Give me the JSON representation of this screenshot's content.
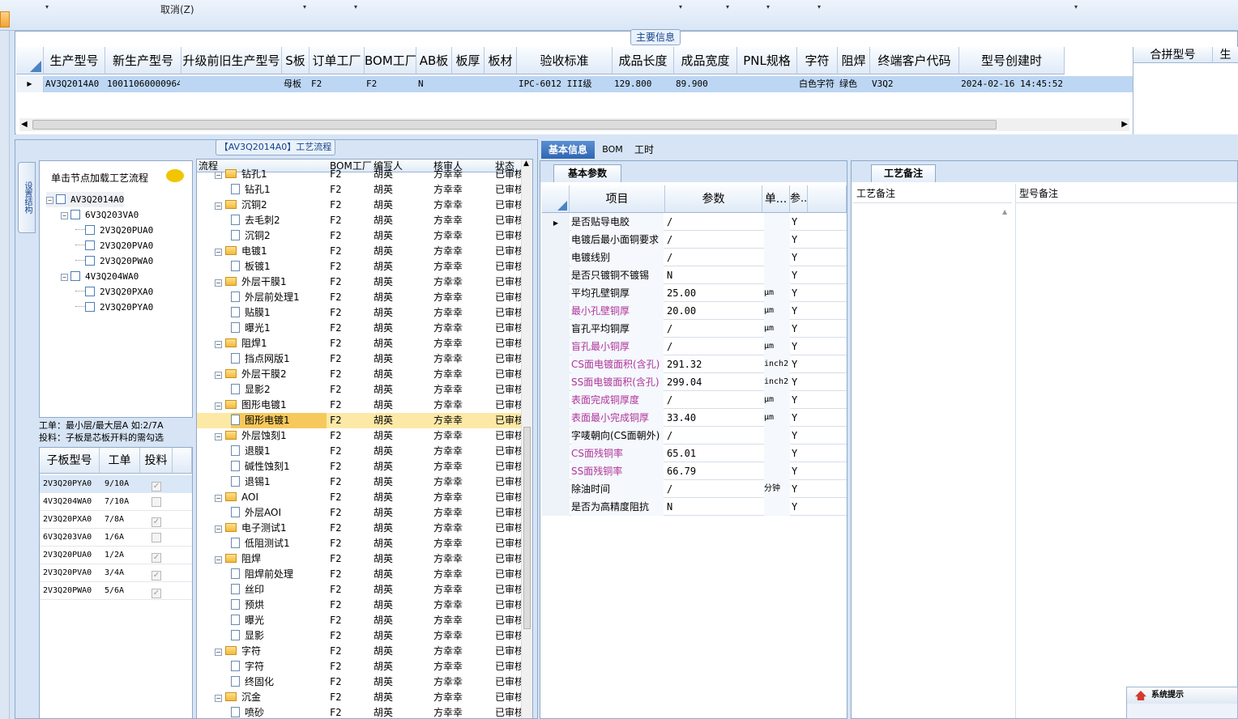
{
  "toolbar": {
    "cancel_label": "取消(Z)",
    "dropdown_glyph": "▾"
  },
  "main_info": {
    "legend": "主要信息",
    "columns": [
      "生产型号",
      "新生产型号",
      "升级前旧生产型号",
      "S板",
      "订单工厂",
      "BOM工厂",
      "AB板",
      "板厚",
      "板材",
      "验收标准",
      "成品长度",
      "成品宽度",
      "PNL规格",
      "字符",
      "阻焊",
      "终端客户代码",
      "型号创建时"
    ],
    "row": [
      "AV3Q2014A0",
      "10011060000964",
      "",
      "母板",
      "F2",
      "F2",
      "N",
      "",
      "",
      "IPC-6012 III级",
      "129.800",
      "89.900",
      "",
      "白色字符",
      "绿色",
      "V3Q2",
      "2024-02-16 14:45:52"
    ],
    "merge_columns": [
      "合拼型号",
      "生"
    ]
  },
  "process_flow": {
    "title": "【AV3Q2014A0】工艺流程"
  },
  "side_tab": "设置结构",
  "tree_panel": {
    "hint": "单击节点加载工艺流程",
    "nodes": [
      {
        "label": "AV3Q2014A0",
        "level": 0,
        "expand": "−"
      },
      {
        "label": "6V3Q203VA0",
        "level": 1,
        "expand": "−"
      },
      {
        "label": "2V3Q20PUA0",
        "level": 2,
        "expand": ""
      },
      {
        "label": "2V3Q20PVA0",
        "level": 2,
        "expand": ""
      },
      {
        "label": "2V3Q20PWA0",
        "level": 2,
        "expand": ""
      },
      {
        "label": "4V3Q204WA0",
        "level": 1,
        "expand": "−"
      },
      {
        "label": "2V3Q20PXA0",
        "level": 2,
        "expand": ""
      },
      {
        "label": "2V3Q20PYA0",
        "level": 2,
        "expand": ""
      }
    ],
    "note1": "工单：最小层/最大层A 如:2/7A",
    "note2": "投料：子板是芯板开料的需勾选",
    "sub_columns": [
      "子板型号",
      "工单",
      "投料"
    ],
    "sub_rows": [
      {
        "model": "2V3Q20PYA0",
        "order": "9/10A",
        "checked": true
      },
      {
        "model": "4V3Q204WA0",
        "order": "7/10A",
        "checked": false
      },
      {
        "model": "2V3Q20PXA0",
        "order": "7/8A",
        "checked": true
      },
      {
        "model": "6V3Q203VA0",
        "order": "1/6A",
        "checked": false
      },
      {
        "model": "2V3Q20PUA0",
        "order": "1/2A",
        "checked": true
      },
      {
        "model": "2V3Q20PVA0",
        "order": "3/4A",
        "checked": true
      },
      {
        "model": "2V3Q20PWA0",
        "order": "5/6A",
        "checked": true
      }
    ]
  },
  "flow_grid": {
    "columns": [
      "流程",
      "BOM工厂",
      "编写人",
      "核审人",
      "状态"
    ],
    "rows": [
      {
        "name": "钻孔1",
        "type": "folder",
        "factory": "F2",
        "writer": "胡英",
        "reviewer": "方幸幸",
        "status": "已审核"
      },
      {
        "name": "钻孔1",
        "type": "doc",
        "factory": "F2",
        "writer": "胡英",
        "reviewer": "方幸幸",
        "status": "已审核"
      },
      {
        "name": "沉铜2",
        "type": "folder",
        "factory": "F2",
        "writer": "胡英",
        "reviewer": "方幸幸",
        "status": "已审核"
      },
      {
        "name": "去毛刺2",
        "type": "doc",
        "factory": "F2",
        "writer": "胡英",
        "reviewer": "方幸幸",
        "status": "已审核"
      },
      {
        "name": "沉铜2",
        "type": "doc",
        "factory": "F2",
        "writer": "胡英",
        "reviewer": "方幸幸",
        "status": "已审核"
      },
      {
        "name": "电镀1",
        "type": "folder",
        "factory": "F2",
        "writer": "胡英",
        "reviewer": "方幸幸",
        "status": "已审核"
      },
      {
        "name": "板镀1",
        "type": "doc",
        "factory": "F2",
        "writer": "胡英",
        "reviewer": "方幸幸",
        "status": "已审核"
      },
      {
        "name": "外层干膜1",
        "type": "folder",
        "factory": "F2",
        "writer": "胡英",
        "reviewer": "方幸幸",
        "status": "已审核"
      },
      {
        "name": "外层前处理1",
        "type": "doc",
        "factory": "F2",
        "writer": "胡英",
        "reviewer": "方幸幸",
        "status": "已审核"
      },
      {
        "name": "贴膜1",
        "type": "doc",
        "factory": "F2",
        "writer": "胡英",
        "reviewer": "方幸幸",
        "status": "已审核"
      },
      {
        "name": "曝光1",
        "type": "doc",
        "factory": "F2",
        "writer": "胡英",
        "reviewer": "方幸幸",
        "status": "已审核"
      },
      {
        "name": "阻焊1",
        "type": "folder",
        "factory": "F2",
        "writer": "胡英",
        "reviewer": "方幸幸",
        "status": "已审核"
      },
      {
        "name": "挡点网版1",
        "type": "doc",
        "factory": "F2",
        "writer": "胡英",
        "reviewer": "方幸幸",
        "status": "已审核"
      },
      {
        "name": "外层干膜2",
        "type": "folder",
        "factory": "F2",
        "writer": "胡英",
        "reviewer": "方幸幸",
        "status": "已审核"
      },
      {
        "name": "显影2",
        "type": "doc",
        "factory": "F2",
        "writer": "胡英",
        "reviewer": "方幸幸",
        "status": "已审核"
      },
      {
        "name": "图形电镀1",
        "type": "folder",
        "factory": "F2",
        "writer": "胡英",
        "reviewer": "方幸幸",
        "status": "已审核"
      },
      {
        "name": "图形电镀1",
        "type": "doc",
        "factory": "F2",
        "writer": "胡英",
        "reviewer": "方幸幸",
        "status": "已审核",
        "selected": true
      },
      {
        "name": "外层蚀刻1",
        "type": "folder",
        "factory": "F2",
        "writer": "胡英",
        "reviewer": "方幸幸",
        "status": "已审核"
      },
      {
        "name": "退膜1",
        "type": "doc",
        "factory": "F2",
        "writer": "胡英",
        "reviewer": "方幸幸",
        "status": "已审核"
      },
      {
        "name": "碱性蚀刻1",
        "type": "doc",
        "factory": "F2",
        "writer": "胡英",
        "reviewer": "方幸幸",
        "status": "已审核"
      },
      {
        "name": "退锡1",
        "type": "doc",
        "factory": "F2",
        "writer": "胡英",
        "reviewer": "方幸幸",
        "status": "已审核"
      },
      {
        "name": "AOI",
        "type": "folder",
        "factory": "F2",
        "writer": "胡英",
        "reviewer": "方幸幸",
        "status": "已审核"
      },
      {
        "name": "外层AOI",
        "type": "doc",
        "factory": "F2",
        "writer": "胡英",
        "reviewer": "方幸幸",
        "status": "已审核"
      },
      {
        "name": "电子测试1",
        "type": "folder",
        "factory": "F2",
        "writer": "胡英",
        "reviewer": "方幸幸",
        "status": "已审核"
      },
      {
        "name": "低阻测试1",
        "type": "doc",
        "factory": "F2",
        "writer": "胡英",
        "reviewer": "方幸幸",
        "status": "已审核"
      },
      {
        "name": "阻焊",
        "type": "folder",
        "factory": "F2",
        "writer": "胡英",
        "reviewer": "方幸幸",
        "status": "已审核"
      },
      {
        "name": "阻焊前处理",
        "type": "doc",
        "factory": "F2",
        "writer": "胡英",
        "reviewer": "方幸幸",
        "status": "已审核"
      },
      {
        "name": "丝印",
        "type": "doc",
        "factory": "F2",
        "writer": "胡英",
        "reviewer": "方幸幸",
        "status": "已审核"
      },
      {
        "name": "预烘",
        "type": "doc",
        "factory": "F2",
        "writer": "胡英",
        "reviewer": "方幸幸",
        "status": "已审核"
      },
      {
        "name": "曝光",
        "type": "doc",
        "factory": "F2",
        "writer": "胡英",
        "reviewer": "方幸幸",
        "status": "已审核"
      },
      {
        "name": "显影",
        "type": "doc",
        "factory": "F2",
        "writer": "胡英",
        "reviewer": "方幸幸",
        "status": "已审核"
      },
      {
        "name": "字符",
        "type": "folder",
        "factory": "F2",
        "writer": "胡英",
        "reviewer": "方幸幸",
        "status": "已审核"
      },
      {
        "name": "字符",
        "type": "doc",
        "factory": "F2",
        "writer": "胡英",
        "reviewer": "方幸幸",
        "status": "已审核"
      },
      {
        "name": "终固化",
        "type": "doc",
        "factory": "F2",
        "writer": "胡英",
        "reviewer": "方幸幸",
        "status": "已审核"
      },
      {
        "name": "沉金",
        "type": "folder",
        "factory": "F2",
        "writer": "胡英",
        "reviewer": "方幸幸",
        "status": "已审核"
      },
      {
        "name": "喷砂",
        "type": "doc",
        "factory": "F2",
        "writer": "胡英",
        "reviewer": "方幸幸",
        "status": "已审核"
      }
    ]
  },
  "right_tabs": [
    "基本信息",
    "BOM",
    "工时"
  ],
  "basic_params": {
    "tab": "基本参数",
    "columns": [
      "项目",
      "参数",
      "单...",
      "参..."
    ],
    "rows": [
      {
        "item": "是否贴导电胶",
        "value": "/",
        "unit": "",
        "flag": "Y",
        "purple": false
      },
      {
        "item": "电镀后最小面铜要求",
        "value": "/",
        "unit": "",
        "flag": "Y",
        "purple": false
      },
      {
        "item": "电镀线别",
        "value": "/",
        "unit": "",
        "flag": "Y",
        "purple": false
      },
      {
        "item": "是否只镀铜不镀锡",
        "value": "N",
        "unit": "",
        "flag": "Y",
        "purple": false
      },
      {
        "item": "平均孔壁铜厚",
        "value": "25.00",
        "unit": "μm",
        "flag": "Y",
        "purple": false
      },
      {
        "item": "最小孔壁铜厚",
        "value": "20.00",
        "unit": "μm",
        "flag": "Y",
        "purple": true
      },
      {
        "item": "盲孔平均铜厚",
        "value": "/",
        "unit": "μm",
        "flag": "Y",
        "purple": false
      },
      {
        "item": "盲孔最小铜厚",
        "value": "/",
        "unit": "μm",
        "flag": "Y",
        "purple": true
      },
      {
        "item": "CS面电镀面积(含孔)",
        "value": "291.32",
        "unit": "inch2",
        "flag": "Y",
        "purple": true
      },
      {
        "item": "SS面电镀面积(含孔)",
        "value": "299.04",
        "unit": "inch2",
        "flag": "Y",
        "purple": true
      },
      {
        "item": "表面完成铜厚度",
        "value": "/",
        "unit": "μm",
        "flag": "Y",
        "purple": true
      },
      {
        "item": "表面最小完成铜厚",
        "value": "33.40",
        "unit": "μm",
        "flag": "Y",
        "purple": true
      },
      {
        "item": "字唛朝向(CS面朝外)",
        "value": "/",
        "unit": "",
        "flag": "Y",
        "purple": false
      },
      {
        "item": "CS面残铜率",
        "value": "65.01",
        "unit": "",
        "flag": "Y",
        "purple": true
      },
      {
        "item": "SS面残铜率",
        "value": "66.79",
        "unit": "",
        "flag": "Y",
        "purple": true
      },
      {
        "item": "除油时间",
        "value": "/",
        "unit": "分钟",
        "flag": "Y",
        "purple": false
      },
      {
        "item": "是否为高精度阻抗",
        "value": "N",
        "unit": "",
        "flag": "Y",
        "purple": false
      }
    ]
  },
  "remarks": {
    "tab": "工艺备注",
    "col1": "工艺备注",
    "col2": "型号备注"
  },
  "system_tip": "系统提示"
}
